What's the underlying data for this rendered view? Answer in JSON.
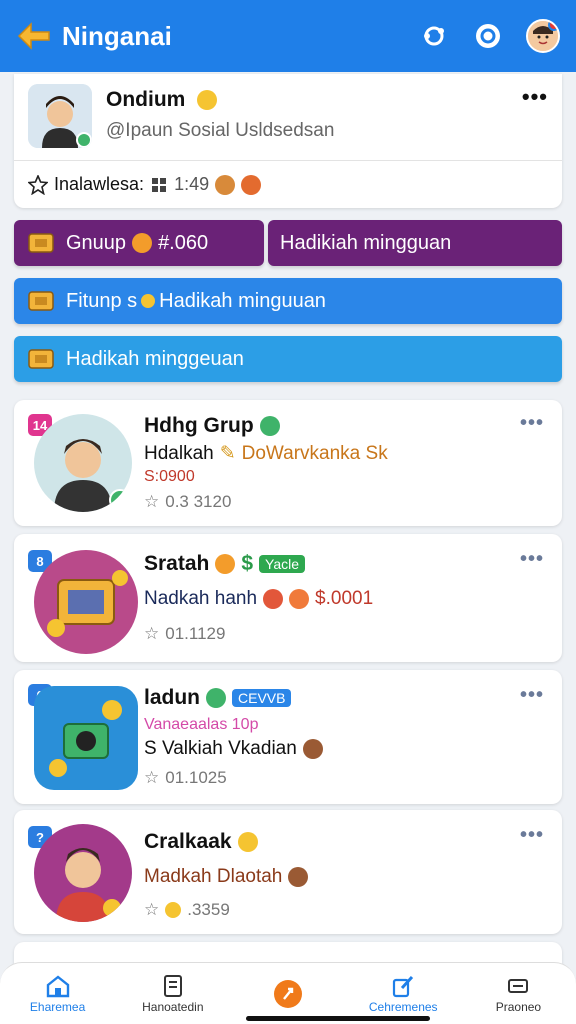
{
  "header": {
    "title": "Ninganai",
    "back_icon": "back-arrow-icon",
    "accent": "#1f7fe8"
  },
  "profile": {
    "name": "Ondium",
    "handle": "@Ipaun Sosial Usldsedsan",
    "stats_label": "Inalawlesa:",
    "stats_value": "1:49"
  },
  "buttons": [
    {
      "label": "Gnuup",
      "extra": "#.060",
      "color": "#6a2277"
    },
    {
      "label": "Hadikiah mingguan",
      "color": "#6a2277"
    },
    {
      "label": "Fitunp s",
      "extra": "Hadikah minguuan",
      "color": "#2b86e8"
    },
    {
      "label": "Hadikah minggeuan",
      "color": "#2c9ee6"
    }
  ],
  "cards": [
    {
      "badge": "14",
      "name": "Hdhg Grup",
      "line1": "Hdalkah",
      "line1_extra": "DoWarvkanka Sk",
      "line2": "S:0900",
      "stat": "0.3 3120"
    },
    {
      "badge": "8",
      "name": "Sratah",
      "tag": "Yacle",
      "line1": "Nadkah hanh",
      "line1_extra": "$.0001",
      "stat": "01.1129"
    },
    {
      "badge": "6",
      "name": "ladun",
      "tag": "CEVVB",
      "line0": "Vanaeaalas 10p",
      "line1": "S Valkiah Vkadian",
      "stat": "01.1025"
    },
    {
      "badge": "?",
      "name": "Cralkaak",
      "line1": "Madkah Dlaotah",
      "stat": ".3359"
    }
  ],
  "bottom_nav": [
    {
      "label": "Eharemea",
      "icon": "home-icon",
      "active": true
    },
    {
      "label": "Hanoatedin",
      "icon": "document-icon",
      "active": false
    },
    {
      "label": "",
      "icon": "center-action-icon",
      "active": false
    },
    {
      "label": "Cehremenes",
      "icon": "edit-icon",
      "active": true
    },
    {
      "label": "Praoneo",
      "icon": "profile-icon",
      "active": false
    }
  ]
}
